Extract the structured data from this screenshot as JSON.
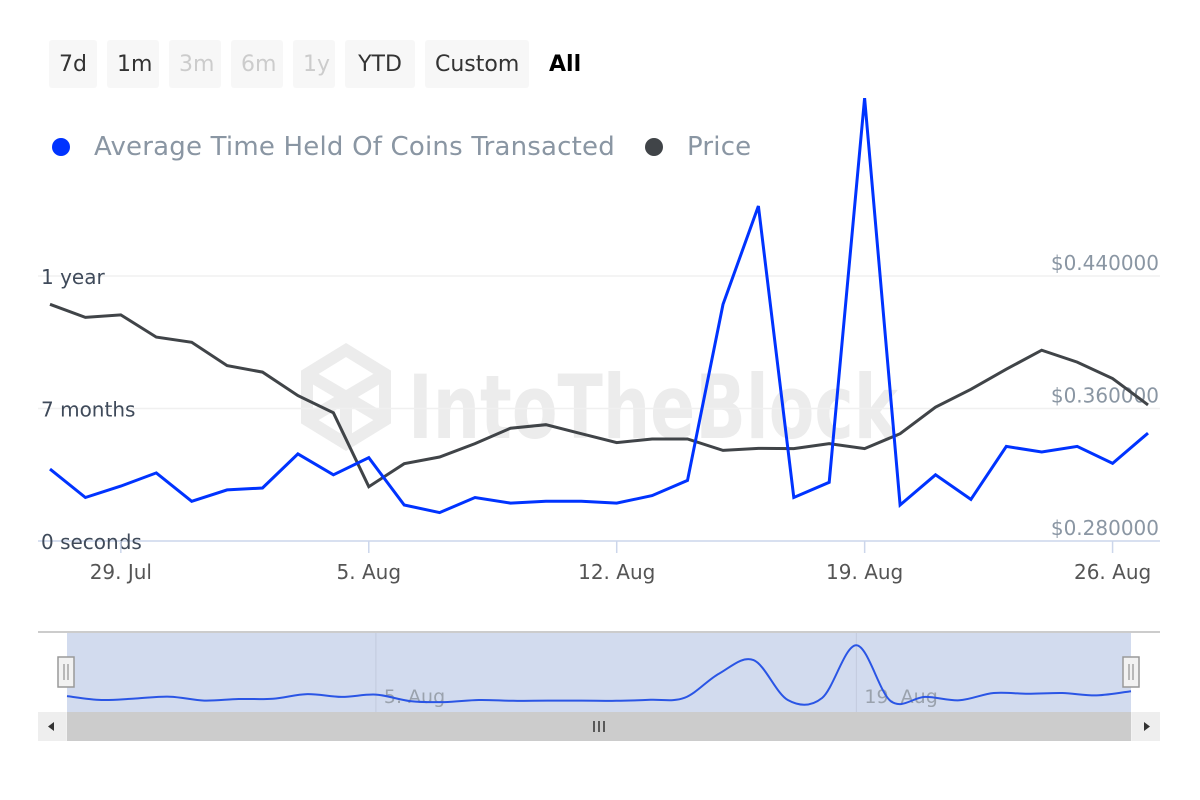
{
  "range_selector": {
    "buttons": [
      {
        "label": "7d",
        "state": "enabled"
      },
      {
        "label": "1m",
        "state": "enabled"
      },
      {
        "label": "3m",
        "state": "disabled"
      },
      {
        "label": "6m",
        "state": "disabled"
      },
      {
        "label": "1y",
        "state": "disabled"
      },
      {
        "label": "YTD",
        "state": "enabled"
      },
      {
        "label": "Custom",
        "state": "enabled"
      },
      {
        "label": "All",
        "state": "selected"
      }
    ]
  },
  "legend": {
    "items": [
      {
        "label": "Average Time Held Of Coins Transacted",
        "color": "#0033ff"
      },
      {
        "label": "Price",
        "color": "#404448"
      }
    ]
  },
  "watermark": "IntoTheBlock",
  "navigator": {
    "tick_labels": [
      "5. Aug",
      "19. Aug"
    ],
    "scroll_left_icon": "arrow-left-icon",
    "scroll_right_icon": "arrow-right-icon",
    "handle_icon": "grip-icon",
    "selected_range": [
      "27 Jul",
      "27 Aug"
    ]
  },
  "chart_data": {
    "type": "line",
    "title": "",
    "xlabel": "",
    "x_start": "27 Jul",
    "x": [
      "27 Jul",
      "28 Jul",
      "29 Jul",
      "30 Jul",
      "31 Jul",
      "1 Aug",
      "2 Aug",
      "3 Aug",
      "4 Aug",
      "5 Aug",
      "6 Aug",
      "7 Aug",
      "8 Aug",
      "9 Aug",
      "10 Aug",
      "11 Aug",
      "12 Aug",
      "13 Aug",
      "14 Aug",
      "15 Aug",
      "16 Aug",
      "17 Aug",
      "18 Aug",
      "19 Aug",
      "20 Aug",
      "21 Aug",
      "22 Aug",
      "23 Aug",
      "24 Aug",
      "25 Aug",
      "26 Aug",
      "27 Aug"
    ],
    "x_ticks": [
      {
        "label": "29. Jul",
        "index": 2
      },
      {
        "label": "5. Aug",
        "index": 9
      },
      {
        "label": "12. Aug",
        "index": 16
      },
      {
        "label": "19. Aug",
        "index": 23
      },
      {
        "label": "26. Aug",
        "index": 30
      }
    ],
    "y_left": {
      "label": "",
      "ticks": [
        "0 seconds",
        "7 months",
        "1 year"
      ],
      "tick_values_months": [
        0,
        7,
        14
      ],
      "range_months": [
        0,
        14
      ]
    },
    "y_right": {
      "label": "",
      "ticks": [
        "$0.280000",
        "$0.360000",
        "$0.440000"
      ],
      "tick_values": [
        0.28,
        0.36,
        0.44
      ],
      "range": [
        0.28,
        0.44
      ]
    },
    "grid": true,
    "legend_position": "top-left",
    "series": [
      {
        "name": "Average Time Held Of Coins Transacted",
        "axis": "left",
        "unit": "months",
        "color": "#0033ff",
        "values": [
          3.8,
          2.3,
          2.9,
          3.6,
          2.1,
          2.7,
          2.8,
          4.6,
          3.5,
          4.4,
          1.9,
          1.5,
          2.3,
          2.0,
          2.1,
          2.1,
          2.0,
          2.4,
          3.2,
          12.5,
          17.7,
          2.3,
          3.1,
          23.4,
          1.9,
          3.5,
          2.2,
          5.0,
          4.7,
          5.0,
          4.1,
          5.7
        ]
      },
      {
        "name": "Price",
        "axis": "right",
        "unit": "USD",
        "color": "#404448",
        "values": [
          0.4229,
          0.415,
          0.4165,
          0.4031,
          0.4,
          0.3859,
          0.382,
          0.3678,
          0.3574,
          0.3128,
          0.3267,
          0.3307,
          0.3388,
          0.3481,
          0.3502,
          0.3448,
          0.3394,
          0.3416,
          0.3416,
          0.3347,
          0.3359,
          0.3358,
          0.3388,
          0.3358,
          0.3448,
          0.3608,
          0.3716,
          0.3837,
          0.3952,
          0.388,
          0.3781,
          0.3622
        ]
      }
    ]
  }
}
